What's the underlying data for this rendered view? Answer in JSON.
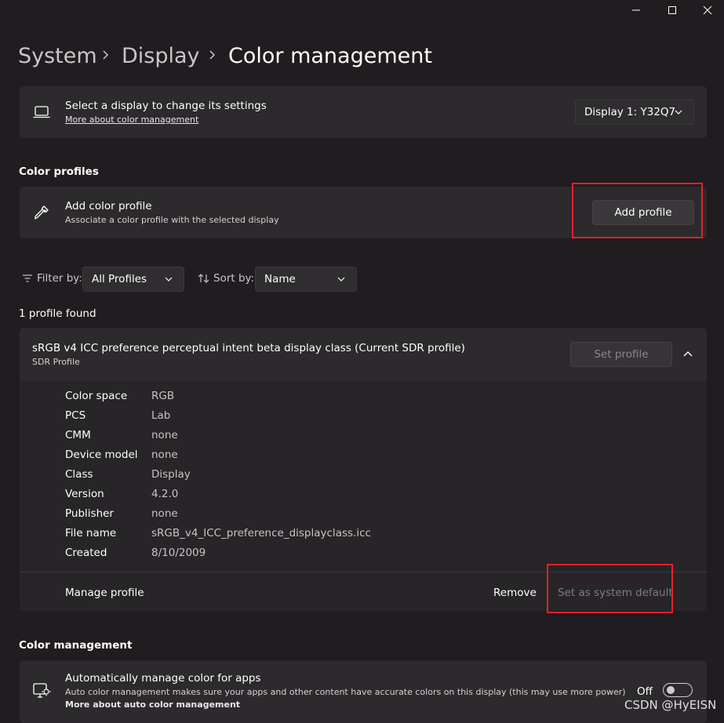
{
  "window_controls": {
    "minimize_icon": "minimize-icon",
    "maximize_icon": "maximize-icon",
    "close_icon": "close-icon"
  },
  "breadcrumb": {
    "items": [
      "System",
      "Display",
      "Color management"
    ]
  },
  "display_select": {
    "title": "Select a display to change its settings",
    "link": "More about color management",
    "value": "Display 1: Y32Q7"
  },
  "color_profiles": {
    "heading": "Color profiles",
    "add_title": "Add color profile",
    "add_subtitle": "Associate a color profile with the selected display",
    "add_button": "Add profile"
  },
  "filters": {
    "filter_label": "Filter by:",
    "filter_value": "All Profiles",
    "sort_label": "Sort by:",
    "sort_value": "Name"
  },
  "results": {
    "count_text": "1 profile found"
  },
  "profile": {
    "name": "sRGB v4 ICC preference perceptual intent beta display class (Current SDR profile)",
    "type": "SDR Profile",
    "set_button": "Set profile",
    "properties": [
      {
        "label": "Color space",
        "value": "RGB"
      },
      {
        "label": "PCS",
        "value": "Lab"
      },
      {
        "label": "CMM",
        "value": "none"
      },
      {
        "label": "Device model",
        "value": "none"
      },
      {
        "label": "Class",
        "value": "Display"
      },
      {
        "label": "Version",
        "value": "4.2.0"
      },
      {
        "label": "Publisher",
        "value": "none"
      },
      {
        "label": "File name",
        "value": "sRGB_v4_ICC_preference_displayclass.icc"
      },
      {
        "label": "Created",
        "value": "8/10/2009"
      }
    ],
    "manage_label": "Manage profile",
    "remove_button": "Remove",
    "default_button": "Set as system default"
  },
  "color_management": {
    "heading": "Color management",
    "auto_title": "Automatically manage color for apps",
    "auto_desc": "Auto color management makes sure your apps and other content have accurate colors on this display (this may use more power)",
    "auto_link": "More about auto color management",
    "toggle_state": "Off"
  },
  "watermark": "CSDN @HyEISN",
  "colors": {
    "background": "#201c1f",
    "card": "#2c2a2c",
    "highlight": "#e8202a"
  }
}
